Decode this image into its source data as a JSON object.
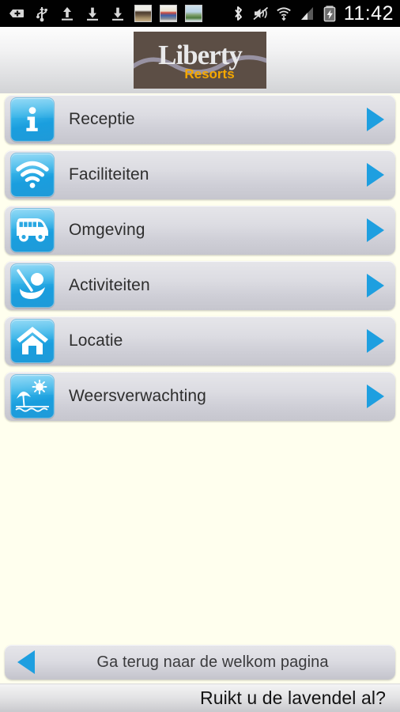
{
  "statusbar": {
    "time": "11:42",
    "left_icons": [
      {
        "name": "vpn-key-icon",
        "label": "VPN"
      },
      {
        "name": "usb-icon",
        "label": "USB"
      },
      {
        "name": "upload-icon",
        "label": "Upload"
      },
      {
        "name": "download-icon",
        "label": "Download"
      },
      {
        "name": "download-icon-2",
        "label": "Download"
      }
    ],
    "thumbnails": [
      {
        "name": "photo-thumbnail-1"
      },
      {
        "name": "photo-thumbnail-2"
      },
      {
        "name": "photo-thumbnail-3"
      }
    ],
    "right_icons": [
      {
        "name": "bluetooth-icon",
        "label": "Bluetooth"
      },
      {
        "name": "mute-icon",
        "label": "Silent / vibrate"
      },
      {
        "name": "wifi-icon",
        "label": "Wi-Fi"
      },
      {
        "name": "cellular-signal-icon",
        "label": "Signal"
      },
      {
        "name": "battery-charging-icon",
        "label": "Battery charging"
      }
    ]
  },
  "header": {
    "logo_primary": "Liberty",
    "logo_secondary": "Resorts",
    "logo_bg": "#5c4e45",
    "logo_primary_color": "#e9e9ea",
    "logo_secondary_color": "#f5a800"
  },
  "menu": {
    "items": [
      {
        "label": "Receptie",
        "icon": "info-icon",
        "chevron": "chevron-right-icon"
      },
      {
        "label": "Faciliteiten",
        "icon": "wifi-icon",
        "chevron": "chevron-right-icon"
      },
      {
        "label": "Omgeving",
        "icon": "bus-icon",
        "chevron": "chevron-right-icon"
      },
      {
        "label": "Activiteiten",
        "icon": "golf-icon",
        "chevron": "chevron-right-icon"
      },
      {
        "label": "Locatie",
        "icon": "home-icon",
        "chevron": "chevron-right-icon"
      },
      {
        "label": "Weersverwachting",
        "icon": "beach-sun-icon",
        "chevron": "chevron-right-icon"
      }
    ]
  },
  "back_bar": {
    "label": "Ga terug naar de welkom pagina",
    "icon": "chevron-left-icon"
  },
  "footer": {
    "ticker": "Ruikt u de lavendel al?"
  },
  "colors": {
    "page_background": "#FFFFEE",
    "accent_blue": "#1E9FE0",
    "row_gradient_top": "#e6e6ea",
    "row_gradient_bottom": "#c6c6ce",
    "text_primary": "#2e2e2e"
  }
}
